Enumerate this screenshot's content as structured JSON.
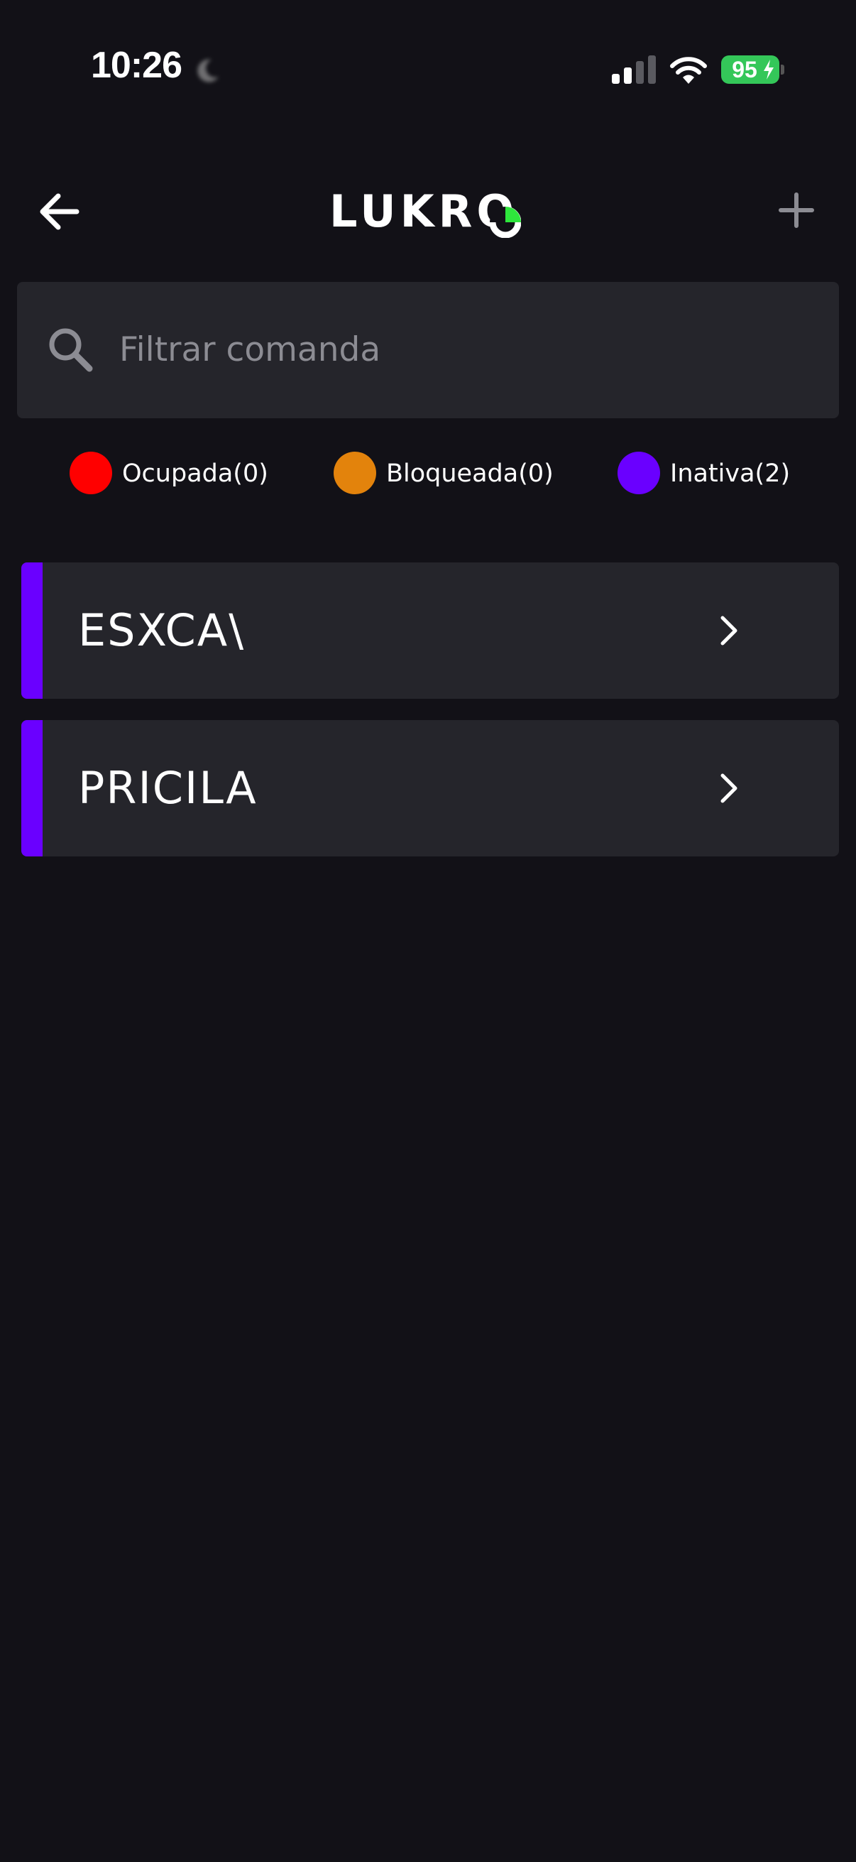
{
  "status_bar": {
    "time": "10:26",
    "battery": "95",
    "icons": [
      "moon-icon",
      "signal-icon",
      "wifi-icon",
      "battery-icon",
      "bolt-icon"
    ],
    "battery_color": "#34c759"
  },
  "header": {
    "logo": "LUKRO",
    "logo_accent_color": "#2ee63c",
    "back_icon": "arrow-left-icon",
    "add_icon": "plus-icon"
  },
  "search": {
    "placeholder": "Filtrar comanda",
    "value": ""
  },
  "legend": {
    "items": [
      {
        "label": "Ocupada(0)",
        "color": "#ff0000"
      },
      {
        "label": "Bloqueada(0)",
        "color": "#e3830c"
      },
      {
        "label": "Inativa(2)",
        "color": "#6a00ff"
      }
    ]
  },
  "comandas": [
    {
      "name": "ESXCA\\",
      "status_color": "#6a00ff"
    },
    {
      "name": "PRICILA",
      "status_color": "#6a00ff"
    }
  ],
  "colors": {
    "background": "#121117",
    "card": "#25252b",
    "placeholder": "#8c8c93"
  }
}
